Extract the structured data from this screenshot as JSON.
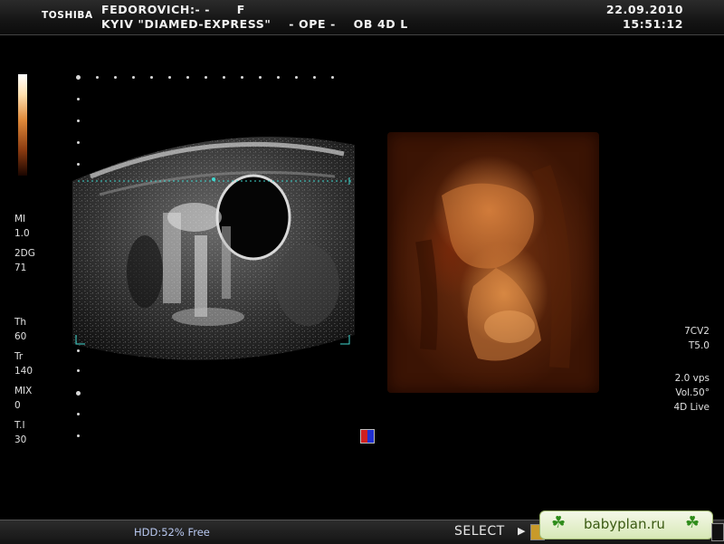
{
  "header": {
    "brand": "TOSHIBA",
    "patient": "FEDOROVICH:- -      F",
    "site": "KYIV \"DIAMED-EXPRESS\"    - OPE -    OB 4D L",
    "date": "22.09.2010",
    "time": "15:51:12"
  },
  "left_params": [
    {
      "label": "MI",
      "value": "1.0"
    },
    {
      "label": "2DG",
      "value": "71"
    },
    {
      "label": "Th",
      "value": "60"
    },
    {
      "label": "Tr",
      "value": "140"
    },
    {
      "label": "MIX",
      "value": "0"
    },
    {
      "label": "T.I",
      "value": "30"
    }
  ],
  "right_params": {
    "probe": "7CV2",
    "t": "T5.0",
    "vps": "2.0 vps",
    "vol": "Vol.50°",
    "mode": "4D Live"
  },
  "footer": {
    "hdd": "HDD:52% Free",
    "select": "SELECT"
  },
  "watermark": {
    "text": "babyplan.ru",
    "icon": "clover-icon"
  },
  "colors": {
    "background": "#000000",
    "render_tone": "#7a3512",
    "guide_line": "#3fd8d0"
  }
}
